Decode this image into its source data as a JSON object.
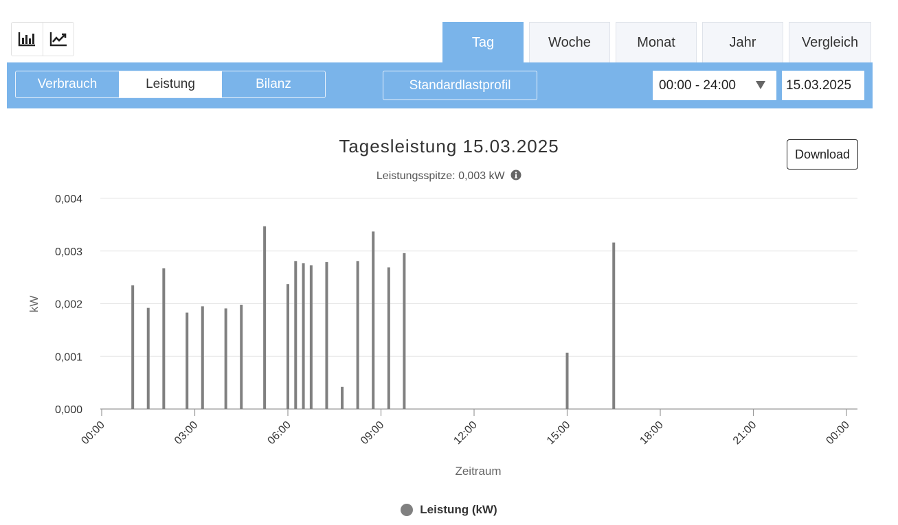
{
  "view_toggle": {
    "icons": [
      "bar-chart-icon",
      "line-chart-icon"
    ]
  },
  "tabs": [
    {
      "label": "Tag",
      "active": true
    },
    {
      "label": "Woche",
      "active": false
    },
    {
      "label": "Monat",
      "active": false
    },
    {
      "label": "Jahr",
      "active": false
    },
    {
      "label": "Vergleich",
      "active": false
    }
  ],
  "controls": {
    "segments": [
      {
        "label": "Verbrauch",
        "active": false
      },
      {
        "label": "Leistung",
        "active": true
      },
      {
        "label": "Bilanz",
        "active": false
      }
    ],
    "standard_profile_label": "Standardlastprofil",
    "time_range": "00:00 - 24:00",
    "date": "15.03.2025"
  },
  "download_label": "Download",
  "colors": {
    "accent": "#7ab4ea",
    "bar": "#808080",
    "grid": "#e6e6e6"
  },
  "chart_data": {
    "type": "bar",
    "title": "Tagesleistung 15.03.2025",
    "subtitle": "Leistungsspitze: 0,003 kW",
    "xlabel": "Zeitraum",
    "ylabel": "kW",
    "ylim": [
      0,
      0.004
    ],
    "yticks": [
      "0,000",
      "0,001",
      "0,002",
      "0,003",
      "0,004"
    ],
    "xlim": [
      0,
      24
    ],
    "xticks": [
      "00:00",
      "03:00",
      "06:00",
      "09:00",
      "12:00",
      "15:00",
      "18:00",
      "21:00",
      "00:00"
    ],
    "grid": true,
    "legend": "bottom",
    "series": [
      {
        "name": "Leistung (kW)",
        "points": [
          {
            "x": "01:00",
            "y": 0.00235
          },
          {
            "x": "01:30",
            "y": 0.00192
          },
          {
            "x": "02:00",
            "y": 0.00267
          },
          {
            "x": "02:45",
            "y": 0.00183
          },
          {
            "x": "03:15",
            "y": 0.00195
          },
          {
            "x": "04:00",
            "y": 0.00191
          },
          {
            "x": "04:30",
            "y": 0.00198
          },
          {
            "x": "05:15",
            "y": 0.00347
          },
          {
            "x": "06:00",
            "y": 0.00237
          },
          {
            "x": "06:15",
            "y": 0.00281
          },
          {
            "x": "06:30",
            "y": 0.00277
          },
          {
            "x": "06:45",
            "y": 0.00273
          },
          {
            "x": "07:15",
            "y": 0.00279
          },
          {
            "x": "07:45",
            "y": 0.00042
          },
          {
            "x": "08:15",
            "y": 0.00281
          },
          {
            "x": "08:45",
            "y": 0.00337
          },
          {
            "x": "09:15",
            "y": 0.00269
          },
          {
            "x": "09:45",
            "y": 0.00296
          },
          {
            "x": "15:00",
            "y": 0.00107
          },
          {
            "x": "16:30",
            "y": 0.00316
          }
        ]
      }
    ]
  }
}
